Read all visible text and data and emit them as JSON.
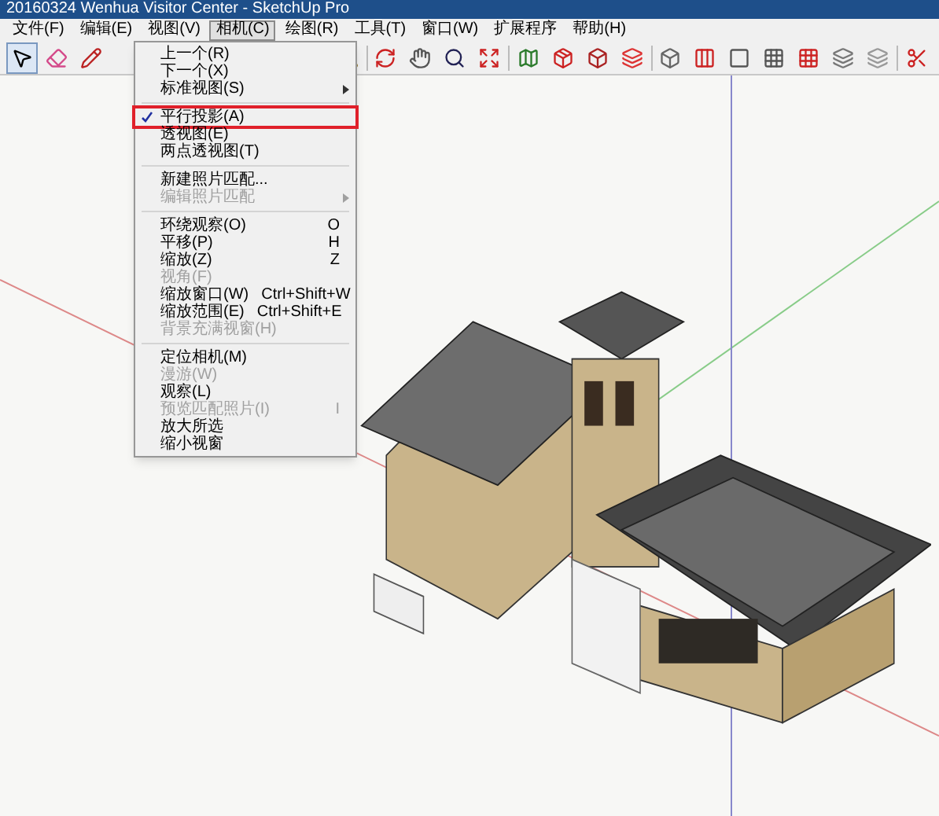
{
  "window": {
    "title": "20160324 Wenhua Visitor Center - SketchUp Pro"
  },
  "menubar": [
    {
      "label": "文件(F)",
      "selected": false
    },
    {
      "label": "编辑(E)",
      "selected": false
    },
    {
      "label": "视图(V)",
      "selected": false
    },
    {
      "label": "相机(C)",
      "selected": true
    },
    {
      "label": "绘图(R)",
      "selected": false
    },
    {
      "label": "工具(T)",
      "selected": false
    },
    {
      "label": "窗口(W)",
      "selected": false
    },
    {
      "label": "扩展程序",
      "selected": false
    },
    {
      "label": "帮助(H)",
      "selected": false
    }
  ],
  "dropdown": [
    {
      "kind": "item",
      "label": "上一个(R)",
      "disabled": false,
      "checked": false,
      "submenu": false,
      "selected": false
    },
    {
      "kind": "item",
      "label": "下一个(X)",
      "disabled": false,
      "checked": false,
      "submenu": false,
      "selected": false
    },
    {
      "kind": "item",
      "label": "标准视图(S)",
      "disabled": false,
      "checked": false,
      "submenu": true,
      "selected": false
    },
    {
      "kind": "separator"
    },
    {
      "kind": "item",
      "label": "平行投影(A)",
      "disabled": false,
      "checked": true,
      "submenu": false,
      "selected": true
    },
    {
      "kind": "item",
      "label": "透视图(E)",
      "disabled": false,
      "checked": false,
      "submenu": false,
      "selected": false
    },
    {
      "kind": "item",
      "label": "两点透视图(T)",
      "disabled": false,
      "checked": false,
      "submenu": false,
      "selected": false
    },
    {
      "kind": "separator"
    },
    {
      "kind": "item",
      "label": "新建照片匹配...",
      "disabled": false,
      "checked": false,
      "submenu": false,
      "selected": false
    },
    {
      "kind": "item",
      "label": "编辑照片匹配",
      "disabled": true,
      "checked": false,
      "submenu": true,
      "selected": false
    },
    {
      "kind": "separator"
    },
    {
      "kind": "item",
      "label": "环绕观察(O)",
      "shortcut": "O",
      "disabled": false,
      "checked": false,
      "submenu": false,
      "selected": false
    },
    {
      "kind": "item",
      "label": "平移(P)",
      "shortcut": "H",
      "disabled": false,
      "checked": false,
      "submenu": false,
      "selected": false
    },
    {
      "kind": "item",
      "label": "缩放(Z)",
      "shortcut": "Z",
      "disabled": false,
      "checked": false,
      "submenu": false,
      "selected": false
    },
    {
      "kind": "item",
      "label": "视角(F)",
      "disabled": true,
      "checked": false,
      "submenu": false,
      "selected": false
    },
    {
      "kind": "item",
      "label": "缩放窗口(W)",
      "shortcut": "Ctrl+Shift+W",
      "disabled": false,
      "checked": false,
      "submenu": false,
      "selected": false
    },
    {
      "kind": "item",
      "label": "缩放范围(E)",
      "shortcut": "Ctrl+Shift+E",
      "disabled": false,
      "checked": false,
      "submenu": false,
      "selected": false
    },
    {
      "kind": "item",
      "label": "背景充满视窗(H)",
      "disabled": true,
      "checked": false,
      "submenu": false,
      "selected": false
    },
    {
      "kind": "separator"
    },
    {
      "kind": "item",
      "label": "定位相机(M)",
      "disabled": false,
      "checked": false,
      "submenu": false,
      "selected": false
    },
    {
      "kind": "item",
      "label": "漫游(W)",
      "disabled": true,
      "checked": false,
      "submenu": false,
      "selected": false
    },
    {
      "kind": "item",
      "label": "观察(L)",
      "disabled": false,
      "checked": false,
      "submenu": false,
      "selected": false
    },
    {
      "kind": "item",
      "label": "预览匹配照片(I)",
      "shortcut": "I",
      "disabled": true,
      "checked": false,
      "submenu": false,
      "selected": false
    },
    {
      "kind": "item",
      "label": "放大所选",
      "disabled": false,
      "checked": false,
      "submenu": false,
      "selected": false
    },
    {
      "kind": "item",
      "label": "缩小视窗",
      "disabled": false,
      "checked": false,
      "submenu": false,
      "selected": false
    }
  ]
}
